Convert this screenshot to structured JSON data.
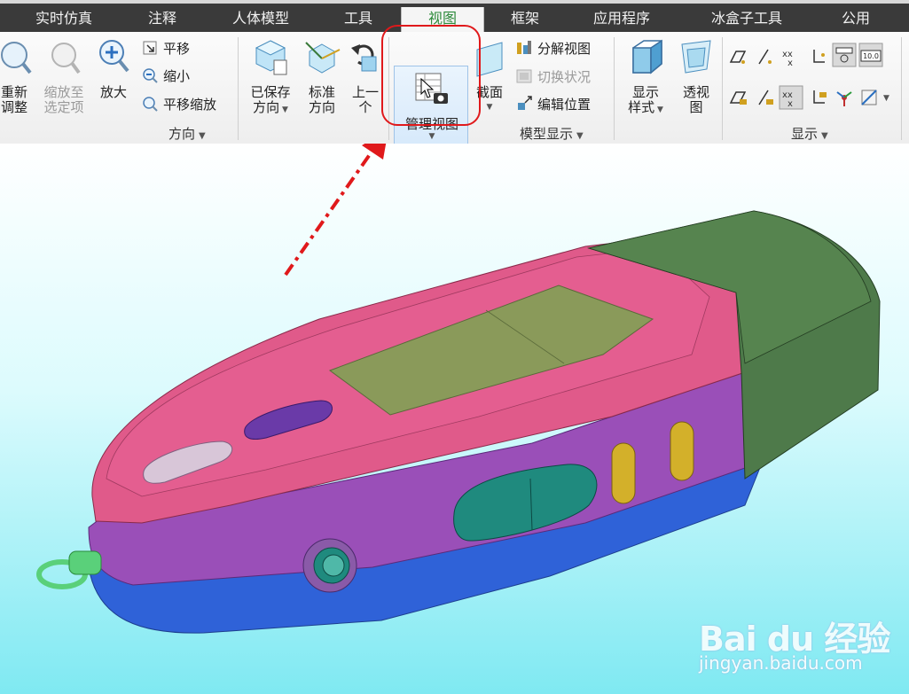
{
  "tabs": [
    {
      "label": "实时仿真"
    },
    {
      "label": "注释"
    },
    {
      "label": "人体模型"
    },
    {
      "label": "工具"
    },
    {
      "label": "视图",
      "active": true
    },
    {
      "label": "框架"
    },
    {
      "label": "应用程序"
    },
    {
      "label": "冰盒子工具"
    },
    {
      "label": "公用"
    }
  ],
  "ribbon": {
    "orientation": {
      "group_label": "方向",
      "refit": "重新\n调整",
      "zoom_selected": "缩放至\n选定项",
      "zoom_in": "放大",
      "pan": "平移",
      "zoom_out": "缩小",
      "pan_zoom": "平移缩放",
      "saved_orient": "已保存\n方向",
      "std_orient": "标准\n方向",
      "previous": "上一\n个"
    },
    "model_display": {
      "group_label": "模型显示",
      "manage_views": "管理视图",
      "section": "截面",
      "exploded_view": "分解视图",
      "toggle_status": "切换状况",
      "edit_position": "编辑位置",
      "display_style": "显示\n样式",
      "perspective": "透视\n图"
    },
    "show": {
      "group_label": "显示",
      "note_value": "10.0"
    }
  },
  "watermark": {
    "logo": "Bai du 经验",
    "url": "jingyan.baidu.com"
  },
  "colors": {
    "accent_red": "#e0191b",
    "tab_bar": "#3a3a3a",
    "active_tab_text": "#2c8a3a",
    "body_pink": "#e05a8a",
    "body_purple": "#9a4fb8",
    "body_blue": "#2f62d8",
    "cap_green": "#4e7a4a",
    "screen_olive": "#8a9a5a"
  }
}
